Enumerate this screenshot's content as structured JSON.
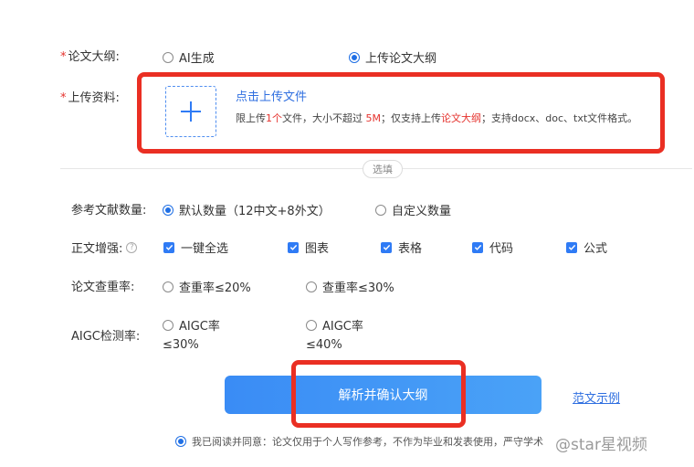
{
  "outline": {
    "required_mark": "*",
    "label": "论文大纲:",
    "options": [
      {
        "label": "AI生成",
        "selected": false
      },
      {
        "label": "上传论文大纲",
        "selected": true
      }
    ]
  },
  "upload": {
    "required_mark": "*",
    "label": "上传资料:",
    "click_text": "点击上传文件",
    "hint_prefix": "限上传",
    "hint_count": "1个",
    "hint_mid": "文件，大小不超过 ",
    "hint_size": "5M",
    "hint_mid2": "；仅支持上传",
    "hint_type": "论文大纲",
    "hint_suffix": "；支持docx、doc、txt文件格式。"
  },
  "divider_label": "选填",
  "references": {
    "label": "参考文献数量:",
    "options": [
      {
        "label": "默认数量（12中文+8外文）",
        "selected": true
      },
      {
        "label": "自定义数量",
        "selected": false
      }
    ]
  },
  "enhance": {
    "label": "正文增强:",
    "help": "?",
    "options": [
      {
        "label": "一键全选",
        "checked": true
      },
      {
        "label": "图表",
        "checked": true
      },
      {
        "label": "表格",
        "checked": true
      },
      {
        "label": "代码",
        "checked": true
      },
      {
        "label": "公式",
        "checked": true
      }
    ]
  },
  "plagiarism": {
    "label": "论文查重率:",
    "options": [
      {
        "label": "查重率≤20%",
        "selected": false
      },
      {
        "label": "查重率≤30%",
        "selected": false
      }
    ]
  },
  "aigc": {
    "label": "AIGC检测率:",
    "options": [
      {
        "line1": "AIGC率",
        "line2": "≤30%",
        "selected": false
      },
      {
        "line1": "AIGC率",
        "line2": "≤40%",
        "selected": false
      }
    ]
  },
  "submit_label": "解析并确认大纲",
  "example_link": "范文示例",
  "agreement": "我已阅读并同意：论文仅用于个人写作参考，不作为毕业和发表使用，严守学术",
  "watermark": "@star星视频",
  "colors": {
    "accent": "#2f7bf5",
    "highlight_frame": "#ea2f23",
    "required": "#e5322d"
  }
}
